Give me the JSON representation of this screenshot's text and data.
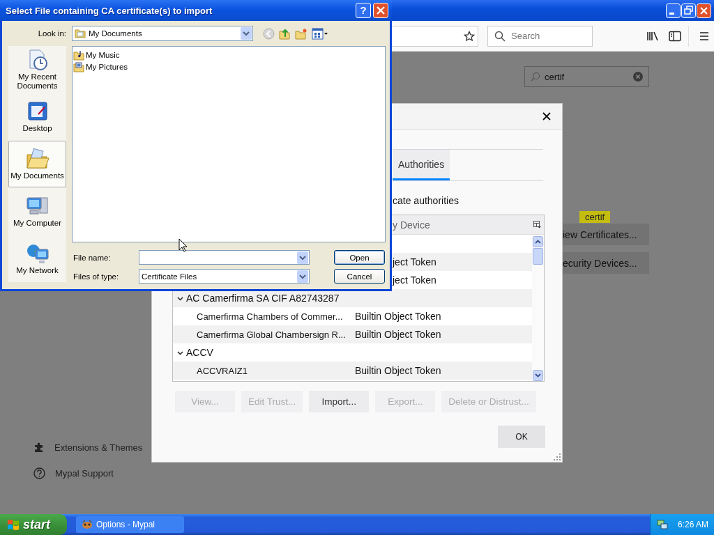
{
  "browser": {
    "toolbar": {
      "search_placeholder": "Search"
    },
    "options_search": {
      "value": "certif"
    },
    "sidebar": [
      {
        "label": "Extensions & Themes",
        "kind": "extensions"
      },
      {
        "label": "Mypal Support",
        "kind": "support"
      }
    ],
    "buttons": [
      {
        "label": "iew Certificates...",
        "tooltip": "certif"
      },
      {
        "label": "ecurity Devices..."
      }
    ]
  },
  "certificate_manager": {
    "tabs": [
      {
        "label": "Authorities",
        "selected": true
      }
    ],
    "description": "cate authorities",
    "columns": [
      "y Device"
    ],
    "rows": [
      {
        "kind": "cut"
      },
      {
        "kind": "cut",
        "device": "ject Token"
      },
      {
        "kind": "cut",
        "device": "ject Token"
      },
      {
        "kind": "group",
        "name": "AC Camerfirma SA CIF A82743287",
        "expanded": true
      },
      {
        "kind": "cert",
        "name": "Camerfirma Chambers of Commer...",
        "device": "Builtin Object Token"
      },
      {
        "kind": "cert",
        "name": "Camerfirma Global Chambersign R...",
        "device": "Builtin Object Token"
      },
      {
        "kind": "group",
        "name": "ACCV",
        "expanded": true
      },
      {
        "kind": "cert",
        "name": "ACCVRAIZ1",
        "device": "Builtin Object Token"
      }
    ],
    "buttons": [
      {
        "label": "View...",
        "disabled": true
      },
      {
        "label": "Edit Trust...",
        "disabled": true
      },
      {
        "label": "Import...",
        "disabled": false
      },
      {
        "label": "Export...",
        "disabled": true
      },
      {
        "label": "Delete or Distrust...",
        "disabled": true
      }
    ],
    "ok": "OK"
  },
  "file_dialog": {
    "title": "Select File containing CA certificate(s) to import",
    "help": "?",
    "look_in_label": "Look in:",
    "look_in": "My Documents",
    "places": [
      {
        "label": "My Recent Documents",
        "kind": "recent",
        "selected": false
      },
      {
        "label": "Desktop",
        "kind": "desktop",
        "selected": false
      },
      {
        "label": "My Documents",
        "kind": "documents",
        "selected": true
      },
      {
        "label": "My Computer",
        "kind": "computer",
        "selected": false
      },
      {
        "label": "My Network",
        "kind": "network",
        "selected": false
      }
    ],
    "files": [
      {
        "name": "My Music",
        "kind": "music"
      },
      {
        "name": "My Pictures",
        "kind": "pictures"
      }
    ],
    "file_name_label": "File name:",
    "file_type_label": "Files of type:",
    "file_type": "Certificate Files",
    "buttons": [
      "Open",
      "Cancel"
    ]
  },
  "taskbar": {
    "start": "start",
    "tasks": [
      {
        "label": "Options - Mypal",
        "selected": false
      }
    ],
    "clock": "6:26 AM"
  }
}
